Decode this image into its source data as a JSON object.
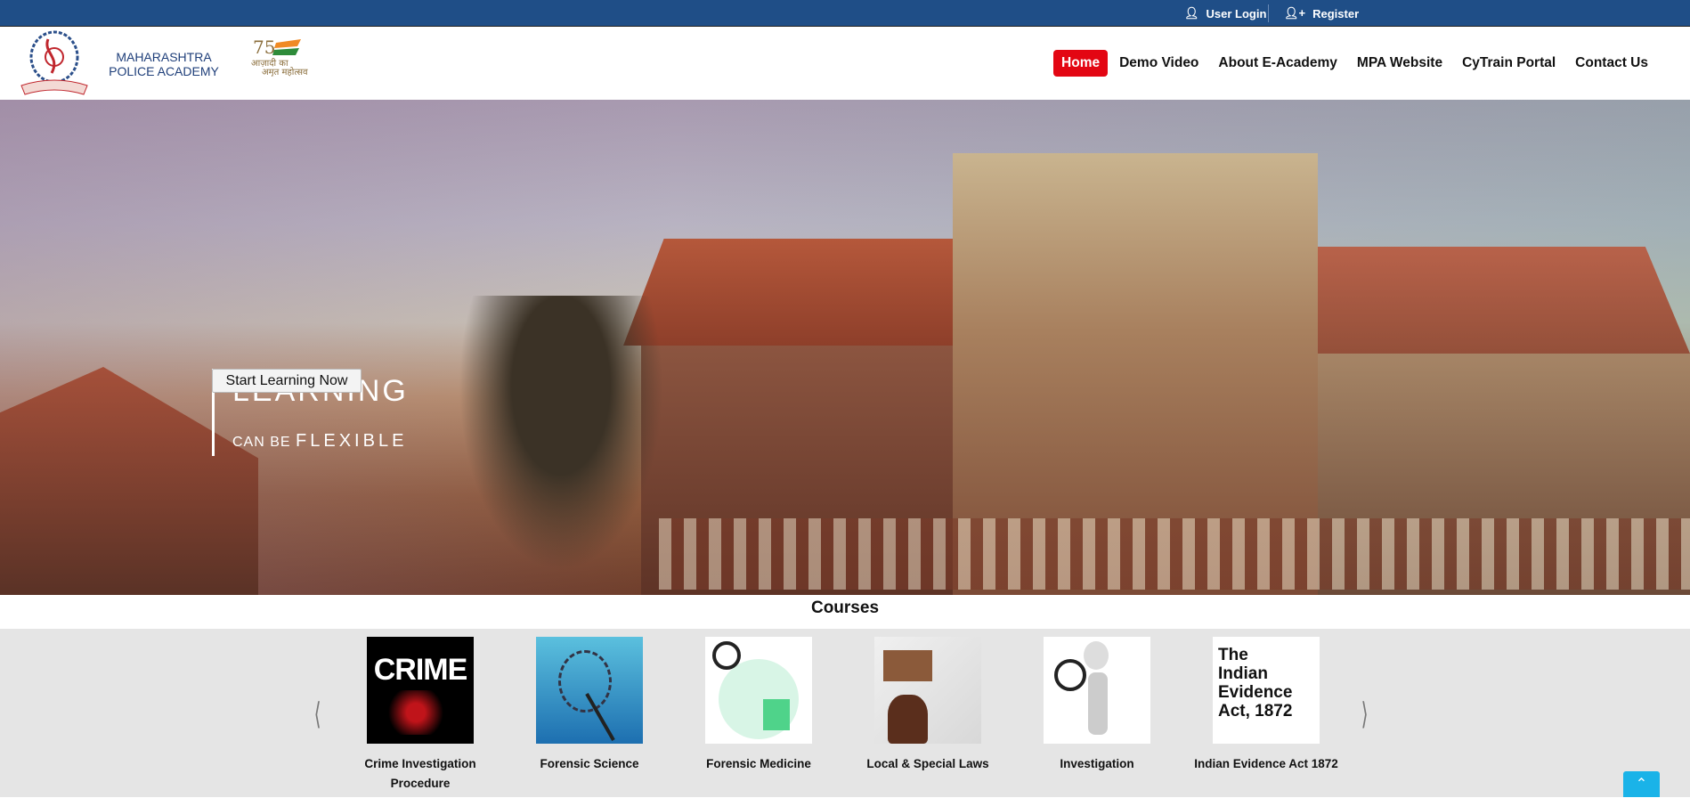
{
  "topbar": {
    "user_login": "User Login",
    "register": "Register",
    "user_icon": "user-icon",
    "register_icon": "user-plus-icon"
  },
  "header": {
    "logo_text": "MAHARASHTRA POLICE ACADEMY",
    "amrit_logo_text": "आज़ादी का अमृत महोत्सव"
  },
  "nav": {
    "items": [
      {
        "label": "Home",
        "active": true
      },
      {
        "label": "Demo Video"
      },
      {
        "label": "About E-Academy"
      },
      {
        "label": "MPA Website"
      },
      {
        "label": "CyTrain Portal"
      },
      {
        "label": "Contact Us"
      }
    ],
    "active_color": "#e30613"
  },
  "hero": {
    "title": "LEARNING",
    "subtitle_small": "CAN BE",
    "subtitle_big": "FLEXIBLE",
    "button": "Start Learning Now"
  },
  "courses": {
    "heading": "Courses",
    "items": [
      {
        "label": "Crime Investigation Procedure",
        "thumb_text": "CRIME"
      },
      {
        "label": "Forensic Science"
      },
      {
        "label": "Forensic Medicine"
      },
      {
        "label": "Local & Special Laws"
      },
      {
        "label": "Investigation"
      },
      {
        "label": "Indian Evidence Act 1872",
        "thumb_text": "The Indian Evidence Act, 1872"
      }
    ],
    "prev_icon": "chevron-left-icon",
    "next_icon": "chevron-right-icon"
  },
  "scroll_top_icon": "chevron-up-icon",
  "colors": {
    "topbar": "#1f4e87",
    "scroll_top": "#1ab3e8"
  }
}
